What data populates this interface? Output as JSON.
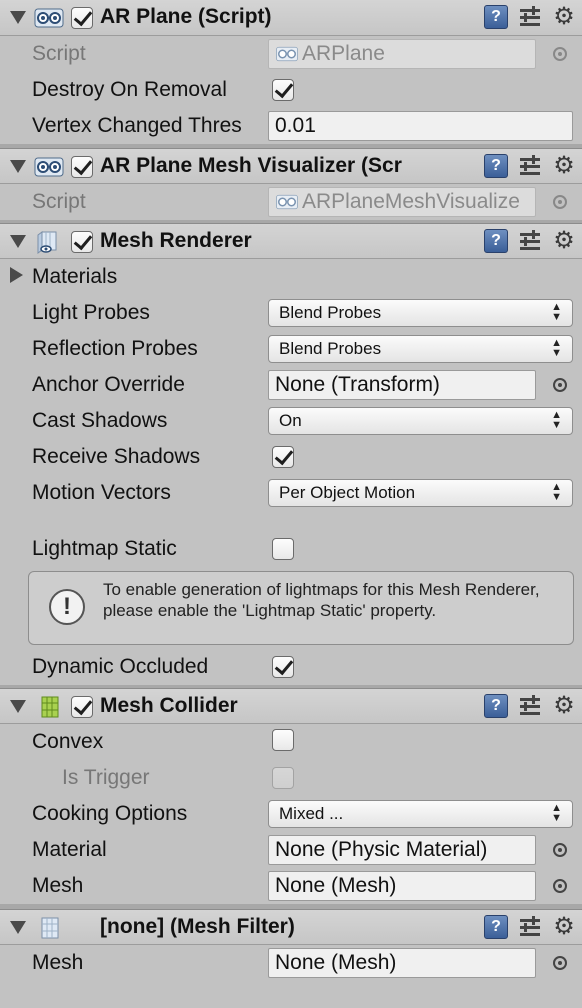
{
  "components": [
    {
      "title": "AR Plane (Script)",
      "enabled": true,
      "icon": "script-icon",
      "fields": {
        "script_label": "Script",
        "script_value": "ARPlane",
        "destroy_label": "Destroy On Removal",
        "destroy_checked": true,
        "vertex_label": "Vertex Changed Thres",
        "vertex_value": "0.01"
      }
    },
    {
      "title": "AR Plane Mesh Visualizer (Scr",
      "enabled": true,
      "icon": "script-icon",
      "fields": {
        "script_label": "Script",
        "script_value": "ARPlaneMeshVisualize"
      }
    },
    {
      "title": "Mesh Renderer",
      "enabled": true,
      "icon": "mesh-renderer-icon",
      "fields": {
        "materials_label": "Materials",
        "light_probes_label": "Light Probes",
        "light_probes_value": "Blend Probes",
        "reflection_probes_label": "Reflection Probes",
        "reflection_probes_value": "Blend Probes",
        "anchor_label": "Anchor Override",
        "anchor_value": "None (Transform)",
        "cast_shadows_label": "Cast Shadows",
        "cast_shadows_value": "On",
        "receive_shadows_label": "Receive Shadows",
        "receive_shadows_checked": true,
        "motion_vectors_label": "Motion Vectors",
        "motion_vectors_value": "Per Object Motion",
        "lightmap_static_label": "Lightmap Static",
        "lightmap_static_checked": false,
        "help_message": "To enable generation of lightmaps for this Mesh Renderer, please enable the 'Lightmap Static' property.",
        "dynamic_occluded_label": "Dynamic Occluded",
        "dynamic_occluded_checked": true
      }
    },
    {
      "title": "Mesh Collider",
      "enabled": true,
      "icon": "mesh-collider-icon",
      "fields": {
        "convex_label": "Convex",
        "convex_checked": false,
        "is_trigger_label": "Is Trigger",
        "is_trigger_checked": false,
        "cooking_label": "Cooking Options",
        "cooking_value": "Mixed ...",
        "material_label": "Material",
        "material_value": "None (Physic Material)",
        "mesh_label": "Mesh",
        "mesh_value": "None (Mesh)"
      }
    },
    {
      "title": "[none] (Mesh Filter)",
      "icon": "mesh-filter-icon",
      "fields": {
        "mesh_label": "Mesh",
        "mesh_value": "None (Mesh)"
      }
    }
  ],
  "icons": {
    "help": "?",
    "gear": "gear-icon",
    "presets": "presets-icon",
    "warning": "!"
  },
  "colors": {
    "background": "#c2c2c2",
    "help_icon": "#4a6ea8",
    "mesh_collider_icon": "#8dbb3c"
  }
}
